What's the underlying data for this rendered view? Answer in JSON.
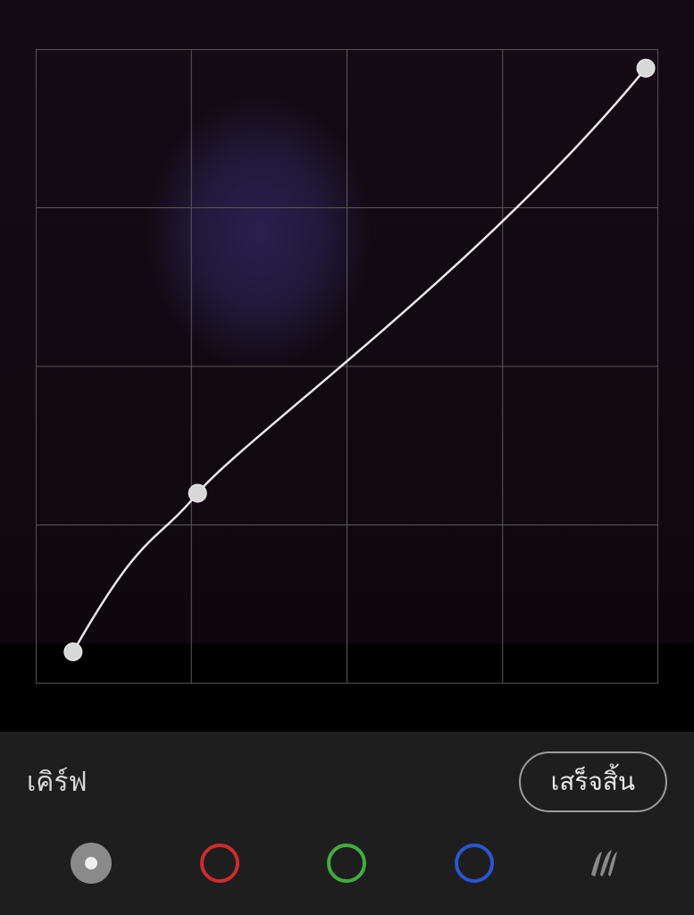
{
  "panel": {
    "title": "เคิร์ฟ",
    "done_label": "เสร็จสิ้น"
  },
  "channels": {
    "luma": "luma",
    "red": "#d02b2b",
    "green": "#3fae3f",
    "blue": "#2b55d0"
  },
  "curve": {
    "grid_divisions": 4,
    "points": [
      {
        "x": 0.06,
        "y": 0.95
      },
      {
        "x": 0.26,
        "y": 0.7
      },
      {
        "x": 0.98,
        "y": 0.03
      }
    ]
  }
}
